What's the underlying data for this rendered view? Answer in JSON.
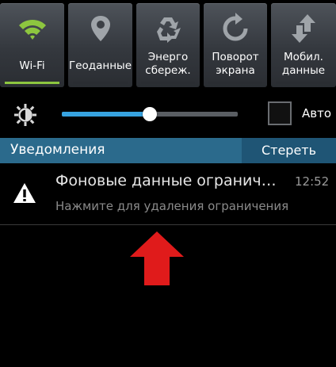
{
  "quick_settings": {
    "tiles": [
      {
        "label": "Wi-Fi",
        "icon": "wifi-icon",
        "active": true
      },
      {
        "label": "Геоданные",
        "icon": "location-pin-icon",
        "active": false
      },
      {
        "label": "Энерго\nсбереж.",
        "icon": "recycle-icon",
        "active": false
      },
      {
        "label": "Поворот\nэкрана",
        "icon": "rotate-icon",
        "active": false
      },
      {
        "label": "Мобил.\nданные",
        "icon": "mobile-data-icon",
        "active": false
      }
    ]
  },
  "brightness": {
    "level": 0.5,
    "auto_label": "Авто",
    "auto_checked": false
  },
  "notifications": {
    "header_title": "Уведомления",
    "clear_label": "Стереть",
    "items": [
      {
        "icon": "warning-icon",
        "title": "Фоновые данные ограничены",
        "time": "12:52",
        "subtitle": "Нажмите для удаления ограничения"
      }
    ]
  },
  "colors": {
    "accent_green": "#8dc63f",
    "header_blue": "#2b6a8c",
    "slider_blue": "#37a3e0",
    "arrow_red": "#e01b1b"
  }
}
